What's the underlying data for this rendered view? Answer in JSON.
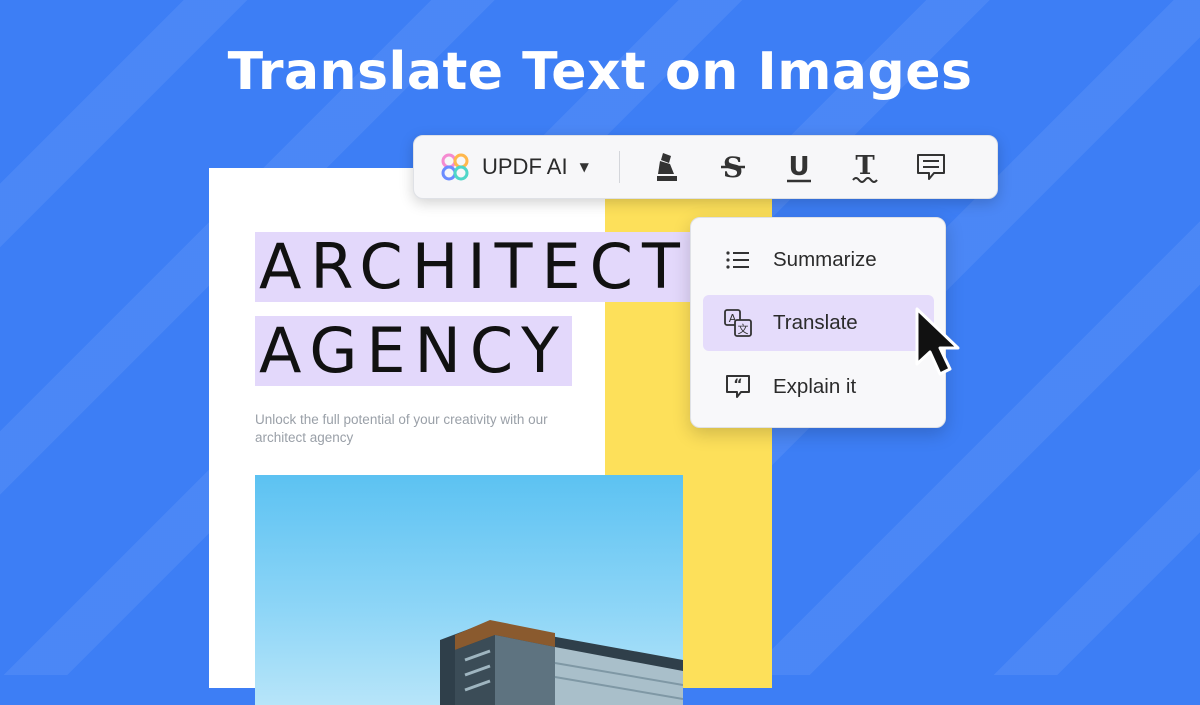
{
  "headline": "Translate Text on Images",
  "toolbar": {
    "ai_label": "UPDF AI",
    "tools": [
      "highlight-icon",
      "strikethrough-icon",
      "underline-icon",
      "squiggly-text-icon",
      "comment-icon"
    ]
  },
  "menu": {
    "items": [
      {
        "label": "Summarize",
        "icon": "list-icon"
      },
      {
        "label": "Translate",
        "icon": "translate-icon",
        "active": true
      },
      {
        "label": "Explain it",
        "icon": "quote-bubble-icon"
      }
    ]
  },
  "document": {
    "title_line1": "ARCHITECT",
    "title_line2": "AGENCY",
    "subtitle": "Unlock the full potential of your creativity with our architect agency"
  },
  "colors": {
    "background": "#3d7ef5",
    "highlight": "#e3d8fb",
    "accent_yellow": "#fde05a",
    "menu_active": "#e5dcfb"
  }
}
